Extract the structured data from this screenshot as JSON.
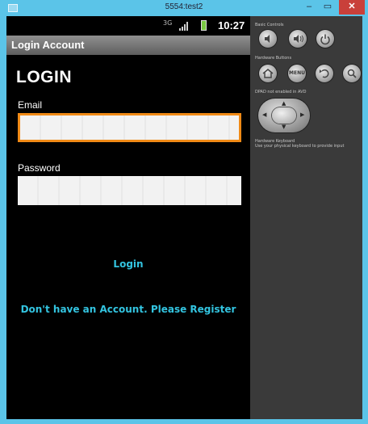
{
  "window": {
    "title": "5554:test2",
    "minimize_label": "–",
    "maximize_label": "▭",
    "close_label": "✕"
  },
  "status_bar": {
    "signal_label": "3G",
    "time": "10:27"
  },
  "action_bar": {
    "title": "Login Account"
  },
  "form": {
    "heading": "LOGIN",
    "email_label": "Email",
    "email_value": "",
    "password_label": "Password",
    "password_value": "",
    "login_link": "Login",
    "register_link": "Don't have an Account. Please Register"
  },
  "emulator_panel": {
    "basic_controls_label": "Basic Controls",
    "hardware_buttons_label": "Hardware Buttons",
    "dpad_label": "DPAD not enabled in AVD",
    "hardware_keyboard_label": "Hardware Keyboard",
    "keyboard_hint": "Use your physical keyboard to provide input",
    "menu_button_label": "MENU"
  },
  "colors": {
    "window_frame": "#5bc4e8",
    "close_button": "#c9403a",
    "focus_border": "#f08a16",
    "link_text": "#33c4e0",
    "panel_bg": "#3a3a3a"
  },
  "icons": {
    "app": "window-icon",
    "volume_down": "volume-down-icon",
    "volume_up": "volume-up-icon",
    "power": "power-icon",
    "home": "home-icon",
    "back": "back-icon",
    "search": "search-icon"
  }
}
